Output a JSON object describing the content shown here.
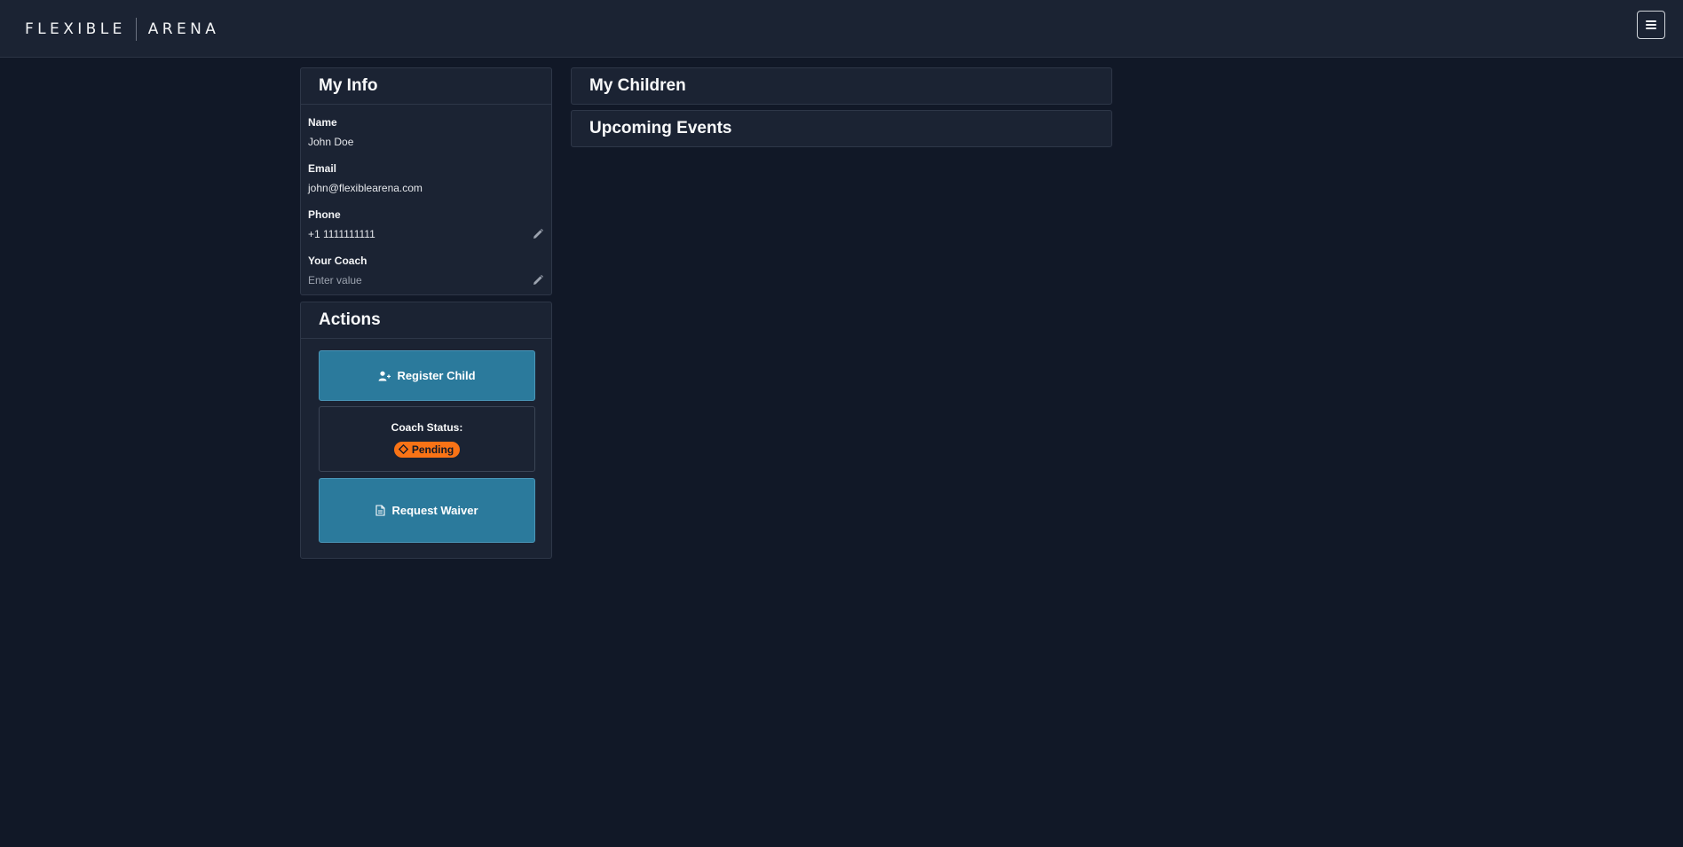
{
  "header": {
    "logo_left": "FLEXIBLE",
    "logo_right": "ARENA",
    "menu_icon": "hamburger-menu-icon"
  },
  "my_info": {
    "title": "My Info",
    "fields": [
      {
        "label": "Name",
        "value": "John Doe",
        "editable": false
      },
      {
        "label": "Email",
        "value": "john@flexiblearena.com",
        "editable": false
      },
      {
        "label": "Phone",
        "value": "+1 1111111111",
        "editable": true
      },
      {
        "label": "Your Coach",
        "value": "",
        "placeholder": "Enter value",
        "editable": true
      }
    ]
  },
  "actions": {
    "title": "Actions",
    "register_child": "Register Child",
    "coach_status_label": "Coach Status:",
    "coach_status_value": "Pending",
    "request_waiver": "Request Waiver"
  },
  "my_children": {
    "title": "My Children"
  },
  "upcoming_events": {
    "title": "Upcoming Events"
  },
  "colors": {
    "background": "#111827",
    "panel": "#1b2333",
    "button": "#2b7a9c",
    "pending_badge": "#f97316",
    "logo_accent": "#9acd32"
  }
}
